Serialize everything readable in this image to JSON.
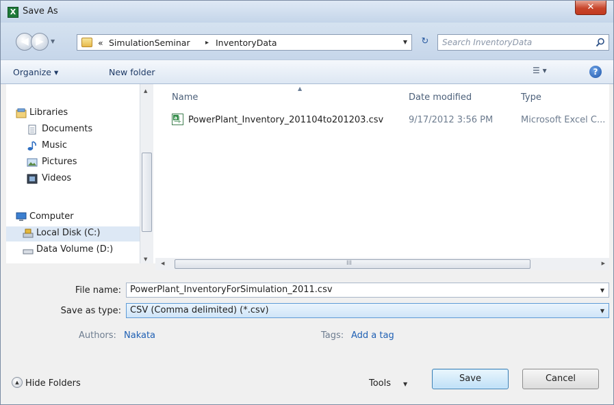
{
  "window": {
    "title": "Save As",
    "close_glyph": "✕",
    "app_icon": "excel-icon",
    "app_icon_glyph": "X"
  },
  "address_bar": {
    "overflow": "«",
    "crumbs": [
      "SimulationSeminar",
      "InventoryData"
    ],
    "separator": "▸",
    "search_placeholder": "Search InventoryData"
  },
  "command_bar": {
    "organize": "Organize ▾",
    "new_folder": "New folder",
    "view_glyph": "☰ ▾",
    "help_glyph": "?"
  },
  "nav_pane": {
    "items": [
      {
        "label": "Libraries",
        "icon": "libraries-icon"
      },
      {
        "label": "Documents",
        "icon": "documents-icon"
      },
      {
        "label": "Music",
        "icon": "music-icon"
      },
      {
        "label": "Pictures",
        "icon": "pictures-icon"
      },
      {
        "label": "Videos",
        "icon": "videos-icon"
      },
      {
        "label": "Computer",
        "icon": "computer-icon"
      },
      {
        "label": "Local Disk (C:)",
        "icon": "local-disk-icon",
        "selected": true
      },
      {
        "label": "Data Volume (D:)",
        "icon": "data-volume-icon"
      }
    ]
  },
  "file_list": {
    "columns": {
      "name": "Name",
      "date": "Date modified",
      "type": "Type"
    },
    "rows": [
      {
        "name": "PowerPlant_Inventory_201104to201203.csv",
        "date": "9/17/2012 3:56 PM",
        "type": "Microsoft Excel C..."
      }
    ],
    "hscroll_glyph": "III"
  },
  "form": {
    "file_name_label": "File name:",
    "file_name_value": "PowerPlant_InventoryForSimulation_2011.csv",
    "save_type_label": "Save as type:",
    "save_type_value": "CSV (Comma delimited) (*.csv)",
    "authors_label": "Authors:",
    "authors_value": "Nakata",
    "tags_label": "Tags:",
    "tags_value": "Add a tag"
  },
  "footer": {
    "hide_folders": "Hide Folders",
    "tools": "Tools",
    "save": "Save",
    "cancel": "Cancel"
  },
  "colors": {
    "accent": "#1e5fb3",
    "selection": "#dde8f5",
    "title_bar": "#c4d5e9"
  }
}
